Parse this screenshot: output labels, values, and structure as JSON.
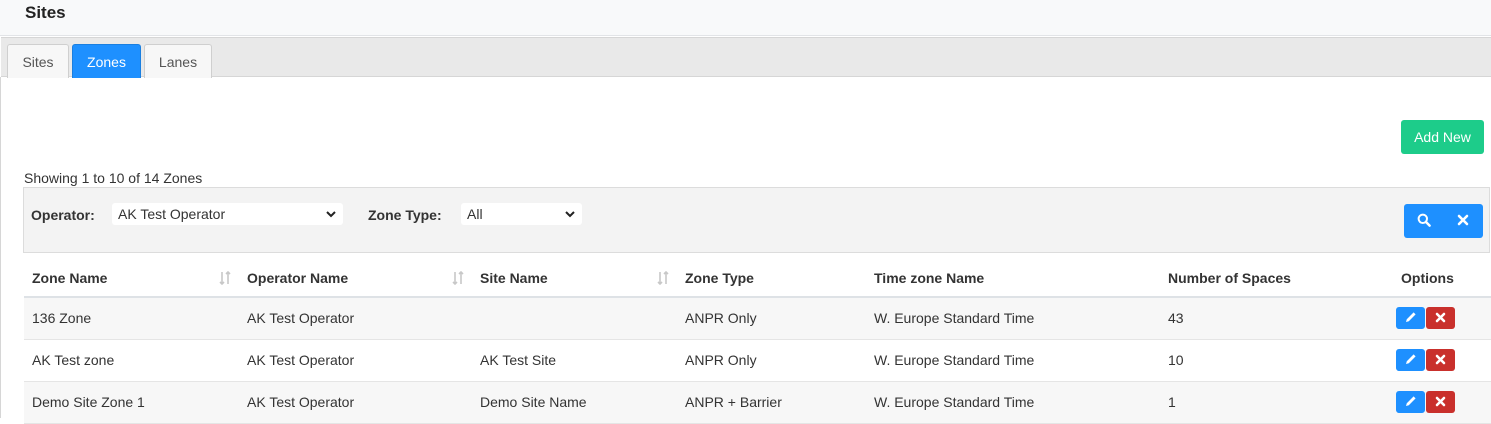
{
  "page": {
    "title": "Sites"
  },
  "tabs": [
    {
      "label": "Sites",
      "active": false
    },
    {
      "label": "Zones",
      "active": true
    },
    {
      "label": "Lanes",
      "active": false
    }
  ],
  "toolbar": {
    "add_new_label": "Add New"
  },
  "summary": {
    "showing": "Showing 1 to 10 of 14 Zones"
  },
  "filters": {
    "operator_label": "Operator:",
    "operator_value": "AK Test Operator",
    "zone_type_label": "Zone Type:",
    "zone_type_value": "All",
    "search_icon": "search-icon",
    "clear_icon": "close-icon"
  },
  "table": {
    "columns": [
      "Zone Name",
      "Operator Name",
      "Site Name",
      "Zone Type",
      "Time zone Name",
      "Number of Spaces",
      "Options"
    ],
    "sortable": [
      true,
      true,
      true,
      false,
      false,
      false,
      false
    ],
    "rows": [
      [
        "136 Zone",
        "AK Test Operator",
        "",
        "ANPR Only",
        "W. Europe Standard Time",
        "43"
      ],
      [
        "AK Test zone",
        "AK Test Operator",
        "AK Test Site",
        "ANPR Only",
        "W. Europe Standard Time",
        "10"
      ],
      [
        "Demo Site Zone 1",
        "AK Test Operator",
        "Demo Site Name",
        "ANPR + Barrier",
        "W. Europe Standard Time",
        "1"
      ]
    ],
    "row_actions": {
      "edit_icon": "pencil-icon",
      "delete_icon": "close-icon"
    }
  },
  "colors": {
    "primary": "#1e90ff",
    "success": "#1dcc8a",
    "danger": "#c9302c"
  }
}
